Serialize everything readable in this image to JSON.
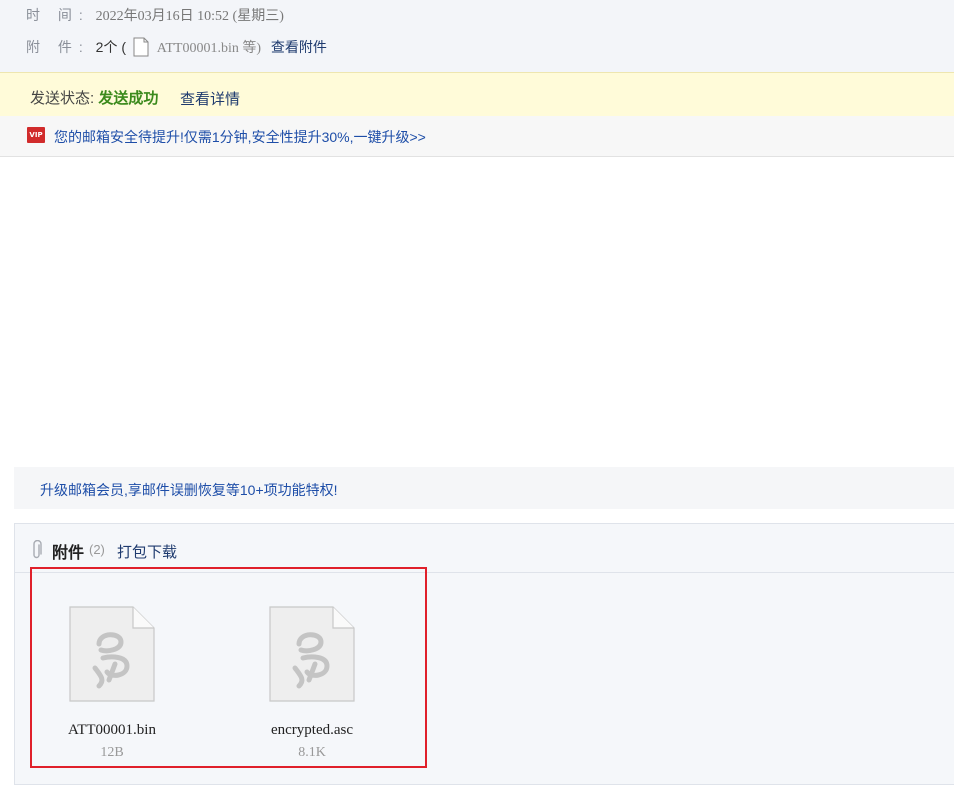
{
  "header": {
    "time_label": "时 间:",
    "time_value": "2022年03月16日 10:52 (星期三)",
    "attach_label": "附 件:",
    "attach_count_text": "2个 (",
    "attach_first_name": "ATT00001.bin 等)",
    "view_attachments": "查看附件"
  },
  "status": {
    "label": "发送状态:",
    "value": "发送成功",
    "detail_link": "查看详情"
  },
  "vip_banner": {
    "icon_text": "VIP",
    "text": "您的邮箱安全待提升!仅需1分钟,安全性提升30%,一键升级>>"
  },
  "upgrade_banner": {
    "text": "升级邮箱会员,享邮件误删恢复等10+项功能特权!"
  },
  "attachments": {
    "title": "附件",
    "count": "(2)",
    "download_all": "打包下载",
    "files": [
      {
        "name": "ATT00001.bin",
        "size": "12B"
      },
      {
        "name": "encrypted.asc",
        "size": "8.1K"
      }
    ]
  },
  "colors": {
    "link": "#1e4ea8",
    "success": "#3b8a1c",
    "highlight": "#e0202a",
    "vip": "#d12b2b"
  }
}
